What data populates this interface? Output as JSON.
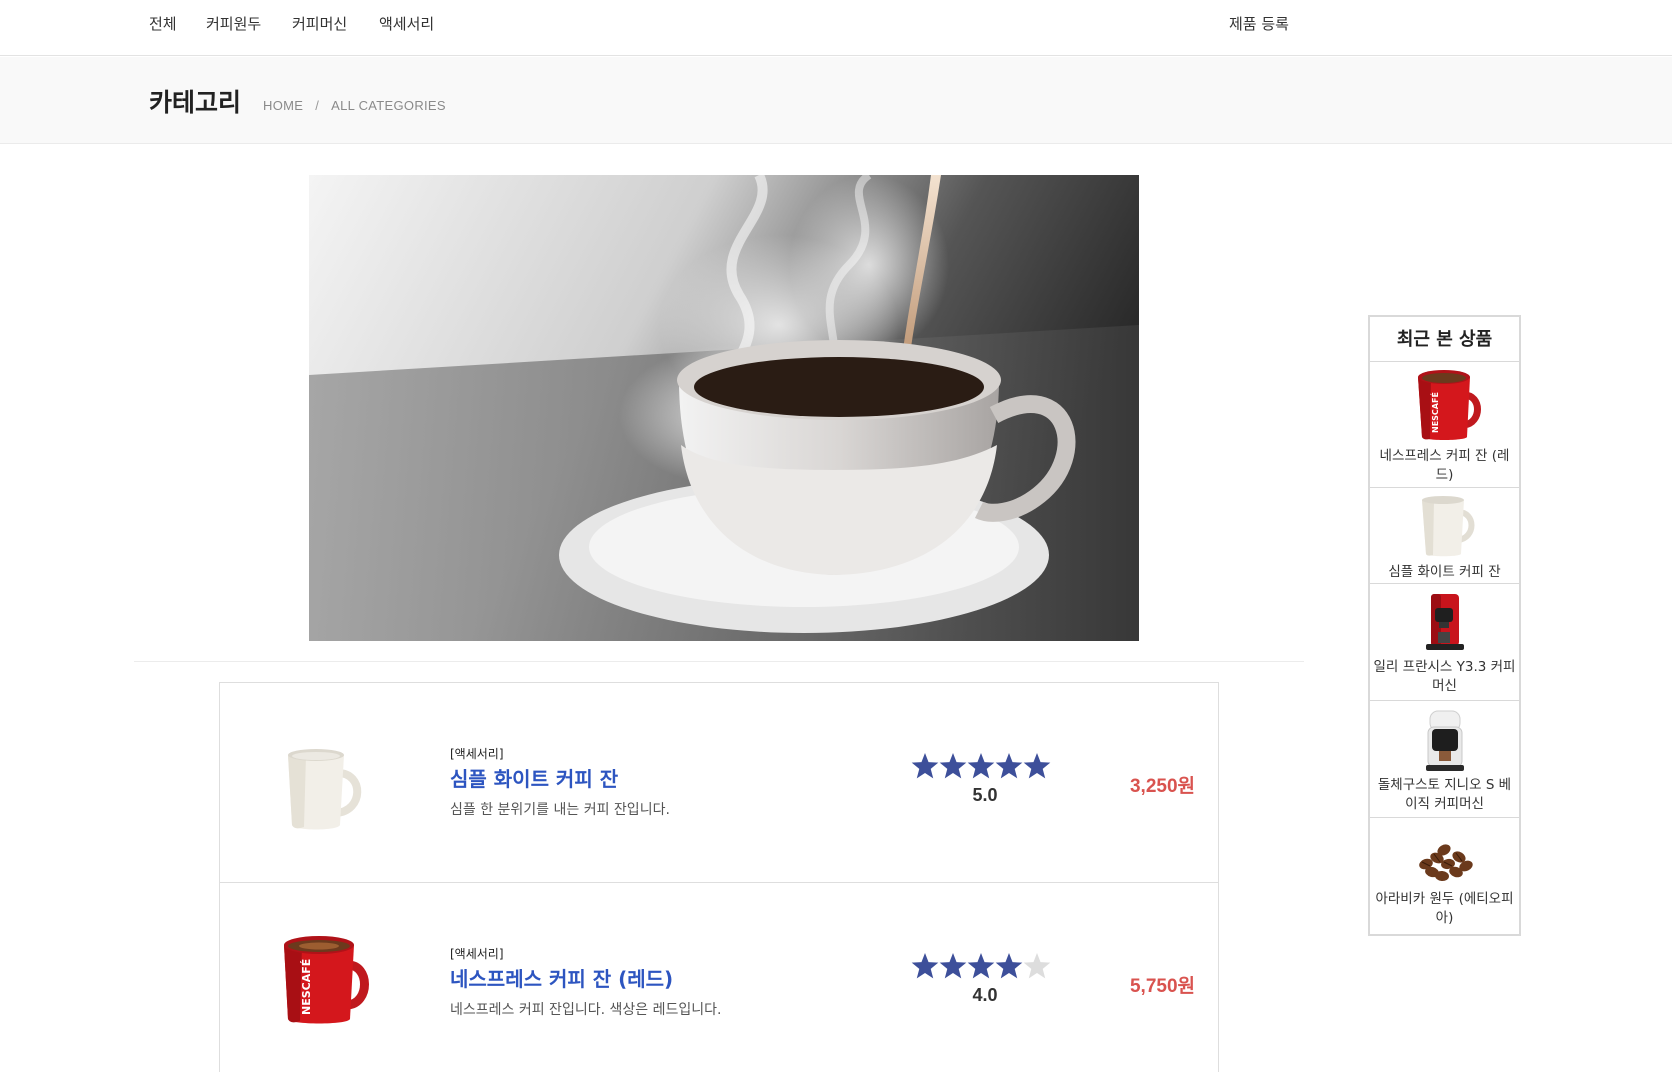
{
  "nav": {
    "items": [
      {
        "label": "전체"
      },
      {
        "label": "커피원두"
      },
      {
        "label": "커피머신"
      },
      {
        "label": "액세서리"
      }
    ],
    "register_label": "제품 등록"
  },
  "page": {
    "title": "카테고리",
    "breadcrumb": [
      "HOME",
      "ALL CATEGORIES"
    ]
  },
  "products": [
    {
      "category": "[액세서리]",
      "name": "심플 화이트 커피 잔",
      "description": "심플 한 분위기를 내는 커피 잔입니다.",
      "rating": 5.0,
      "rating_text": "5.0",
      "price": "3,250원"
    },
    {
      "category": "[액세서리]",
      "name": "네스프레스 커피 잔 (레드)",
      "description": "네스프레스 커피 잔입니다. 색상은 레드입니다.",
      "rating": 4.0,
      "rating_text": "4.0",
      "price": "5,750원"
    }
  ],
  "recent": {
    "title": "최근 본 상품",
    "items": [
      {
        "label": "네스프레스 커피 잔 (레드)"
      },
      {
        "label": "심플 화이트 커피 잔"
      },
      {
        "label": "일리 프란시스 Y3.3 커피머신"
      },
      {
        "label": "돌체구스토 지니오 S 베이직 커피머신"
      },
      {
        "label": "아라비카 원두 (에티오피아)"
      }
    ]
  },
  "colors": {
    "star_filled": "#3d4f9a",
    "star_empty": "#dddddd",
    "price": "#d9534f",
    "product_name": "#2d55c0"
  }
}
